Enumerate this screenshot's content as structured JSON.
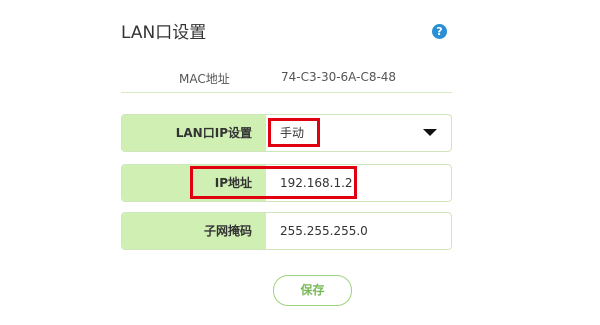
{
  "section": {
    "title": "LAN口设置",
    "help_icon": "help-circle-icon",
    "help_glyph": "?"
  },
  "mac": {
    "label": "MAC地址",
    "value": "74-C3-30-6A-C8-48"
  },
  "fields": [
    {
      "label": "LAN口IP设置",
      "value": "手动",
      "type": "select"
    },
    {
      "label": "IP地址",
      "value": "192.168.1.2",
      "type": "text"
    },
    {
      "label": "子网掩码",
      "value": "255.255.255.0",
      "type": "text"
    }
  ],
  "actions": {
    "save_label": "保存"
  },
  "colors": {
    "label_bg": "#cfefb3",
    "border": "#cfe6bc",
    "highlight": "#e0000f",
    "button_text": "#7ab95a"
  }
}
